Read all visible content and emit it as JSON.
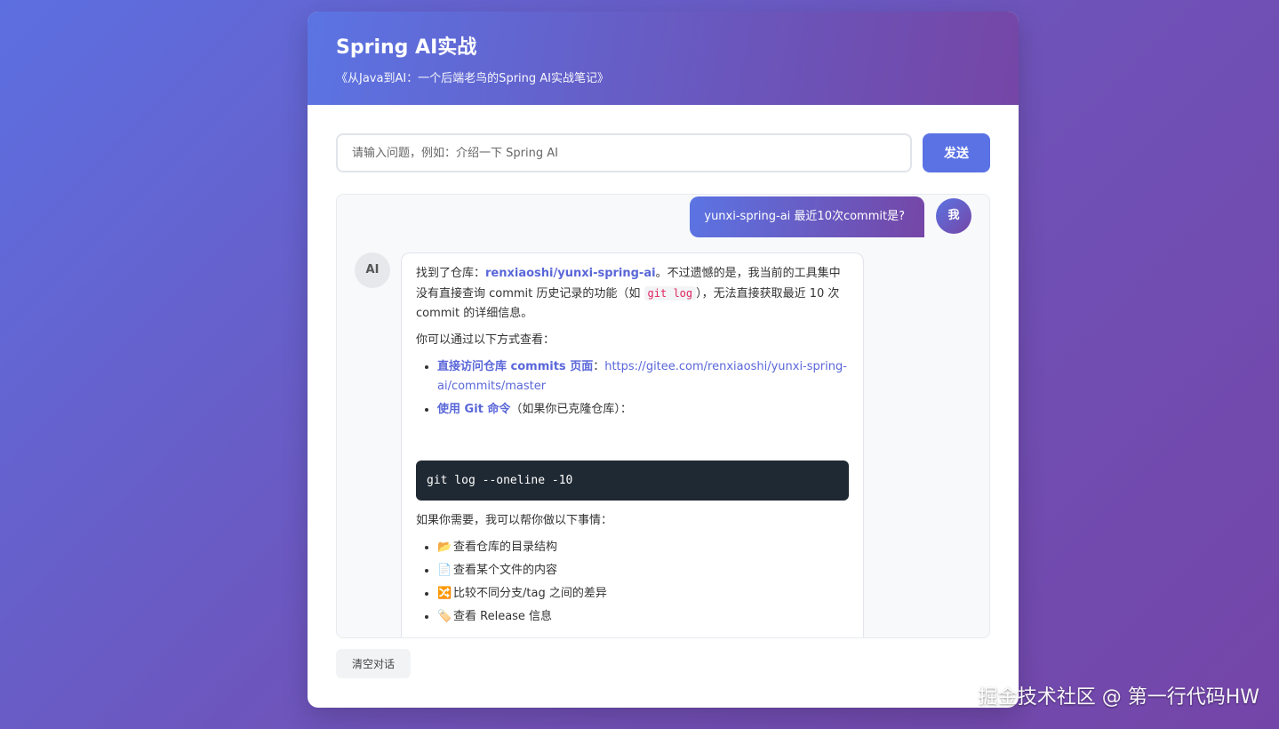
{
  "header": {
    "title": "Spring AI实战",
    "subtitle": "《从Java到AI：一个后端老鸟的Spring AI实战笔记》"
  },
  "input": {
    "value": "",
    "placeholder": "请输入问题，例如：介绍一下 Spring AI"
  },
  "send_label": "发送",
  "messages": {
    "user": {
      "avatar": "我",
      "text": "yunxi-spring-ai 最近10次commit是?"
    },
    "ai": {
      "avatar": "AI",
      "p1_prefix": "找到了仓库：",
      "p1_repo": "renxiaoshi/yunxi-spring-ai",
      "p1_mid": "。不过遗憾的是，我当前的工具集中没有直接查询 commit 历史记录的功能（如 ",
      "p1_code": "git log",
      "p1_suffix": "），无法直接获取最近 10 次 commit 的详细信息。",
      "p2": "你可以通过以下方式查看：",
      "list1": [
        {
          "strong": "直接访问仓库 commits 页面",
          "sep": "：",
          "link": "https://gitee.com/renxiaoshi/yunxi-spring-ai/commits/master",
          "rest": ""
        },
        {
          "strong": "使用 Git 命令",
          "sep": "",
          "link": "",
          "rest": "（如果你已克隆仓库）："
        }
      ],
      "code": "git log --oneline -10",
      "p3": "如果你需要，我可以帮你做以下事情：",
      "list2": [
        {
          "icon": "📂",
          "text": "查看仓库的目录结构"
        },
        {
          "icon": "📄",
          "text": "查看某个文件的内容"
        },
        {
          "icon": "🔀",
          "text": "比较不同分支/tag 之间的差异"
        },
        {
          "icon": "🏷️",
          "text": "查看 Release 信息"
        }
      ]
    }
  },
  "clear_label": "清空对话",
  "watermark": "掘金技术社区 @ 第一行代码HW",
  "colors": {
    "accent": "#5a72e4",
    "gradient_start": "#5b74e3",
    "gradient_end": "#7546a6",
    "code_bg": "#1f2933"
  }
}
